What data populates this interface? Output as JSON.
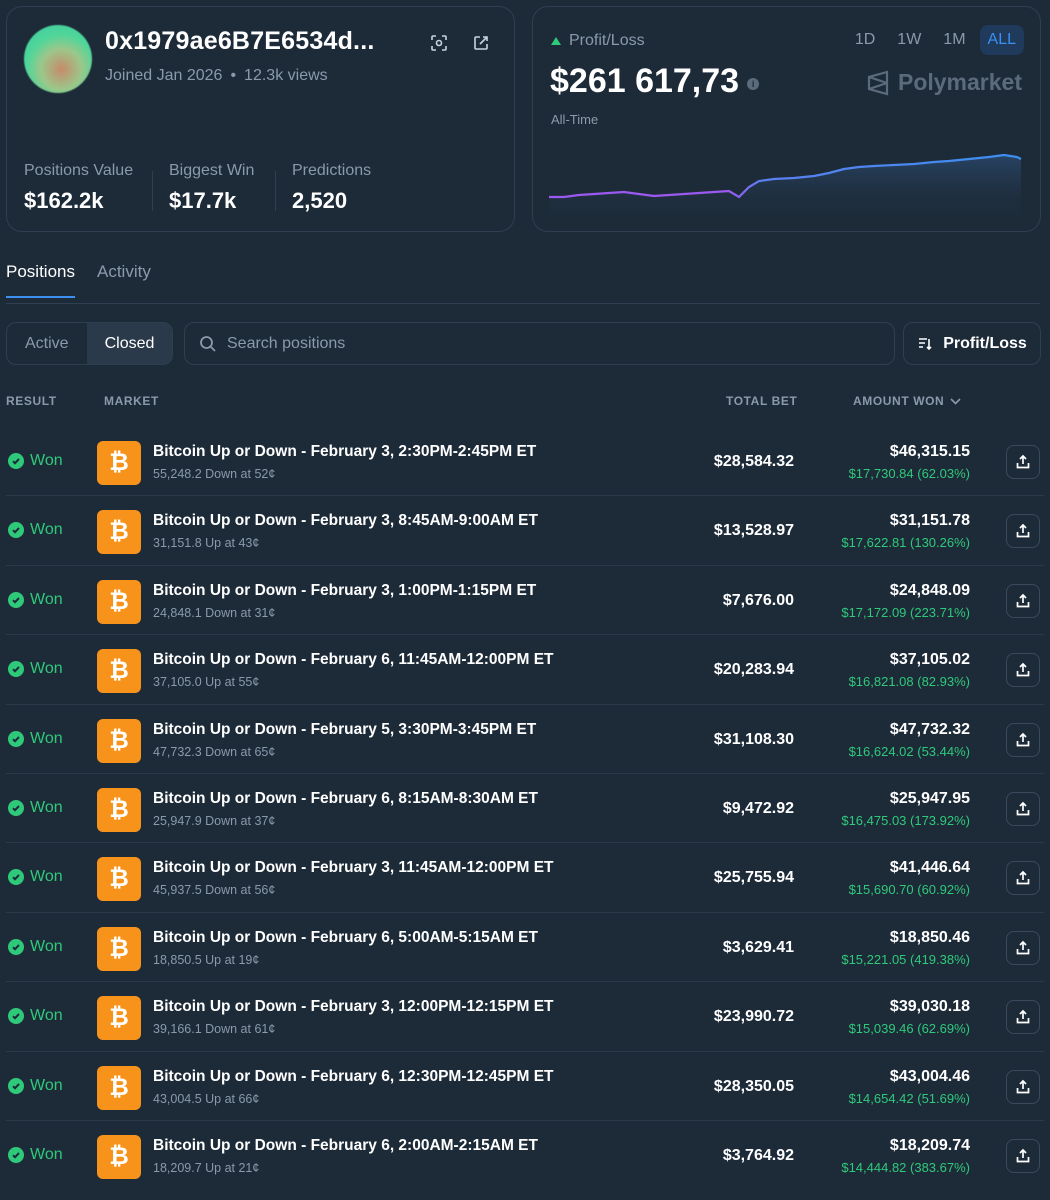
{
  "profile": {
    "username": "0x1979ae6B7E6534d...",
    "joined": "Joined Jan 2026",
    "views": "12.3k views",
    "stats": [
      {
        "label": "Positions Value",
        "value": "$162.2k"
      },
      {
        "label": "Biggest Win",
        "value": "$17.7k"
      },
      {
        "label": "Predictions",
        "value": "2,520"
      }
    ]
  },
  "pnl": {
    "label": "Profit/Loss",
    "value": "$261 617,73",
    "period": "All-Time",
    "brand": "Polymarket",
    "timeframes": [
      "1D",
      "1W",
      "1M",
      "ALL"
    ],
    "active_timeframe": "ALL",
    "colors": {
      "up": "#2fc97a",
      "line_start": "#9b59f0",
      "line_end": "#3b8ff0"
    }
  },
  "tabs": [
    "Positions",
    "Activity"
  ],
  "filters": {
    "segments": [
      "Active",
      "Closed"
    ],
    "active": "Closed"
  },
  "search": {
    "placeholder": "Search positions"
  },
  "sort": {
    "label": "Profit/Loss"
  },
  "table": {
    "headers": {
      "result": "RESULT",
      "market": "MARKET",
      "total_bet": "TOTAL BET",
      "amount_won": "AMOUNT WON"
    },
    "rows": [
      {
        "result": "Won",
        "title": "Bitcoin Up or Down - February 3, 2:30PM-2:45PM ET",
        "sub": "55,248.2 Down at 52¢",
        "bet": "$28,584.32",
        "won": "$46,315.15",
        "profit": "$17,730.84 (62.03%)"
      },
      {
        "result": "Won",
        "title": "Bitcoin Up or Down - February 3, 8:45AM-9:00AM ET",
        "sub": "31,151.8 Up at 43¢",
        "bet": "$13,528.97",
        "won": "$31,151.78",
        "profit": "$17,622.81 (130.26%)"
      },
      {
        "result": "Won",
        "title": "Bitcoin Up or Down - February 3, 1:00PM-1:15PM ET",
        "sub": "24,848.1 Down at 31¢",
        "bet": "$7,676.00",
        "won": "$24,848.09",
        "profit": "$17,172.09 (223.71%)"
      },
      {
        "result": "Won",
        "title": "Bitcoin Up or Down - February 6, 11:45AM-12:00PM ET",
        "sub": "37,105.0 Up at 55¢",
        "bet": "$20,283.94",
        "won": "$37,105.02",
        "profit": "$16,821.08 (82.93%)"
      },
      {
        "result": "Won",
        "title": "Bitcoin Up or Down - February 5, 3:30PM-3:45PM ET",
        "sub": "47,732.3 Down at 65¢",
        "bet": "$31,108.30",
        "won": "$47,732.32",
        "profit": "$16,624.02 (53.44%)"
      },
      {
        "result": "Won",
        "title": "Bitcoin Up or Down - February 6, 8:15AM-8:30AM ET",
        "sub": "25,947.9 Down at 37¢",
        "bet": "$9,472.92",
        "won": "$25,947.95",
        "profit": "$16,475.03 (173.92%)"
      },
      {
        "result": "Won",
        "title": "Bitcoin Up or Down - February 3, 11:45AM-12:00PM ET",
        "sub": "45,937.5 Down at 56¢",
        "bet": "$25,755.94",
        "won": "$41,446.64",
        "profit": "$15,690.70 (60.92%)"
      },
      {
        "result": "Won",
        "title": "Bitcoin Up or Down - February 6, 5:00AM-5:15AM ET",
        "sub": "18,850.5 Up at 19¢",
        "bet": "$3,629.41",
        "won": "$18,850.46",
        "profit": "$15,221.05 (419.38%)"
      },
      {
        "result": "Won",
        "title": "Bitcoin Up or Down - February 3, 12:00PM-12:15PM ET",
        "sub": "39,166.1 Down at 61¢",
        "bet": "$23,990.72",
        "won": "$39,030.18",
        "profit": "$15,039.46 (62.69%)"
      },
      {
        "result": "Won",
        "title": "Bitcoin Up or Down - February 6, 12:30PM-12:45PM ET",
        "sub": "43,004.5 Up at 66¢",
        "bet": "$28,350.05",
        "won": "$43,004.46",
        "profit": "$14,654.42 (51.69%)"
      },
      {
        "result": "Won",
        "title": "Bitcoin Up or Down - February 6, 2:00AM-2:15AM ET",
        "sub": "18,209.7 Up at 21¢",
        "bet": "$3,764.92",
        "won": "$18,209.74",
        "profit": "$14,444.82 (383.67%)"
      }
    ]
  }
}
